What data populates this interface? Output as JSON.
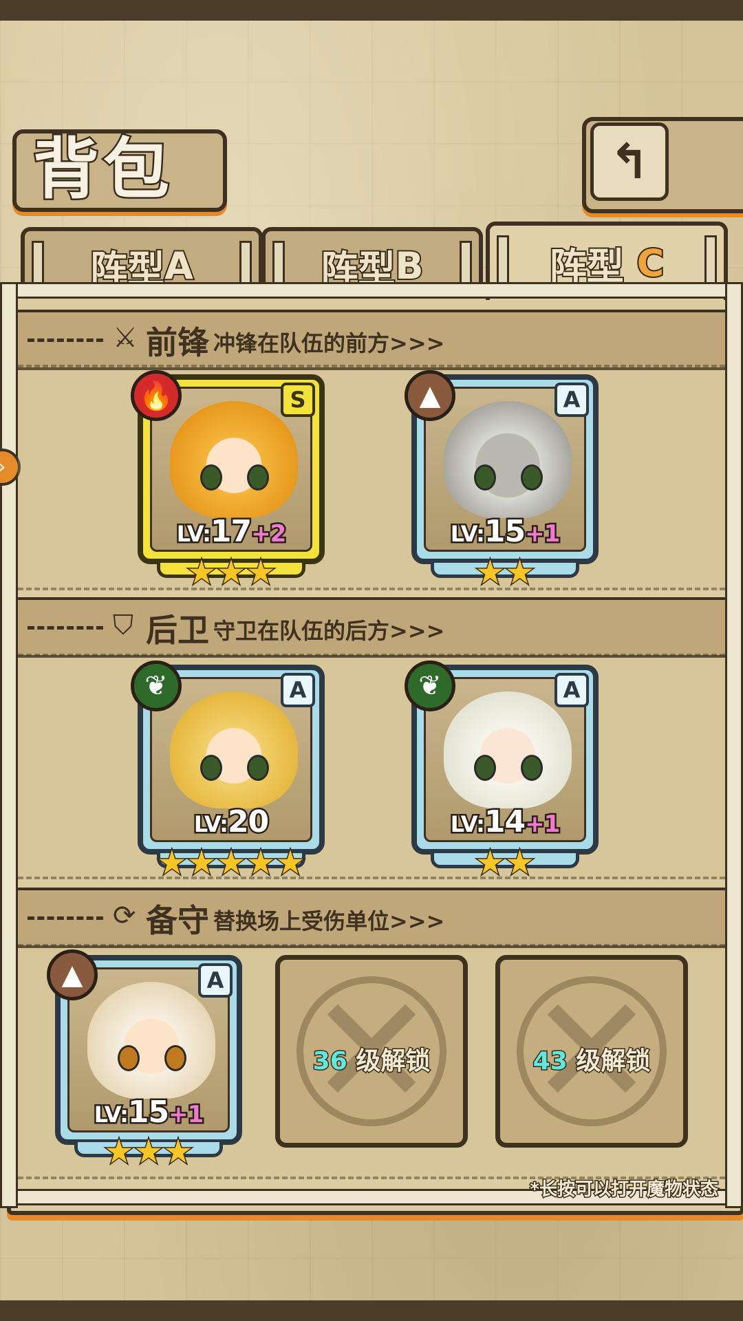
{
  "header": {
    "title": "背包",
    "back_icon": "↰"
  },
  "tabs": [
    {
      "prefix": "阵型",
      "letter": "A",
      "active": false
    },
    {
      "prefix": "阵型",
      "letter": "B",
      "active": false
    },
    {
      "prefix": "阵型",
      "letter": "C",
      "active": true
    }
  ],
  "sections": {
    "front": {
      "icon": "sword-icon",
      "title": "前锋",
      "desc": "冲锋在队伍的前方>>>"
    },
    "back": {
      "icon": "shield-icon",
      "title": "后卫",
      "desc": "守卫在队伍的后方>>>"
    },
    "reserve": {
      "icon": "swap-icon",
      "title": "备守",
      "desc": "替换场上受伤单位>>>"
    }
  },
  "units": {
    "front_1": {
      "element": "fire",
      "grade": "S",
      "lv_prefix": "LV:",
      "level": "17",
      "bonus": "+2",
      "stars": "★★★"
    },
    "front_2": {
      "element": "earth",
      "grade": "A",
      "lv_prefix": "LV:",
      "level": "15",
      "bonus": "+1",
      "stars": "★★"
    },
    "back_1": {
      "element": "wood",
      "grade": "A",
      "lv_prefix": "LV:",
      "level": "20",
      "bonus": "",
      "stars": "★★★★★"
    },
    "back_2": {
      "element": "wood",
      "grade": "A",
      "lv_prefix": "LV:",
      "level": "14",
      "bonus": "+1",
      "stars": "★★"
    },
    "reserve_1": {
      "element": "earth",
      "grade": "A",
      "lv_prefix": "LV:",
      "level": "15",
      "bonus": "+1",
      "stars": "★★★"
    }
  },
  "locked_slots": [
    {
      "level": "36",
      "label": "级解锁"
    },
    {
      "level": "43",
      "label": "级解锁"
    }
  ],
  "hint": "*长按可以打开魔物状态",
  "colors": {
    "accent_orange": "#e58b2a",
    "frame_dark": "#3f3120",
    "card_blue": "#a9dbe9",
    "card_gold": "#f3e23c",
    "bonus_pink": "#f07ad0",
    "unlock_cyan": "#5fe8e0"
  }
}
